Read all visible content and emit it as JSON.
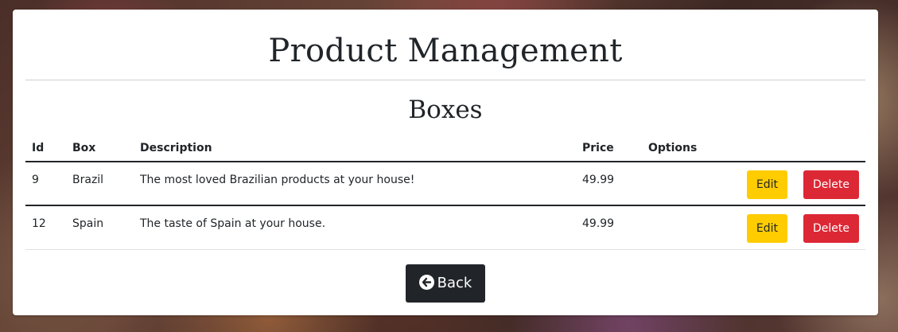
{
  "header": {
    "title": "Product Management"
  },
  "section": {
    "title": "Boxes"
  },
  "table": {
    "columns": [
      "Id",
      "Box",
      "Description",
      "Price",
      "Options"
    ],
    "rows": [
      {
        "id": "9",
        "box": "Brazil",
        "description": "The most loved Brazilian products at your house!",
        "price": "49.99",
        "edit_label": "Edit",
        "delete_label": "Delete"
      },
      {
        "id": "12",
        "box": "Spain",
        "description": "The taste of Spain at your house.",
        "price": "49.99",
        "edit_label": "Edit",
        "delete_label": "Delete"
      }
    ]
  },
  "footer": {
    "back_label": "Back",
    "back_icon": "arrow-circle-left-icon"
  },
  "colors": {
    "edit_button": "#ffcc00",
    "delete_button": "#dc2835",
    "back_button": "#212529"
  }
}
